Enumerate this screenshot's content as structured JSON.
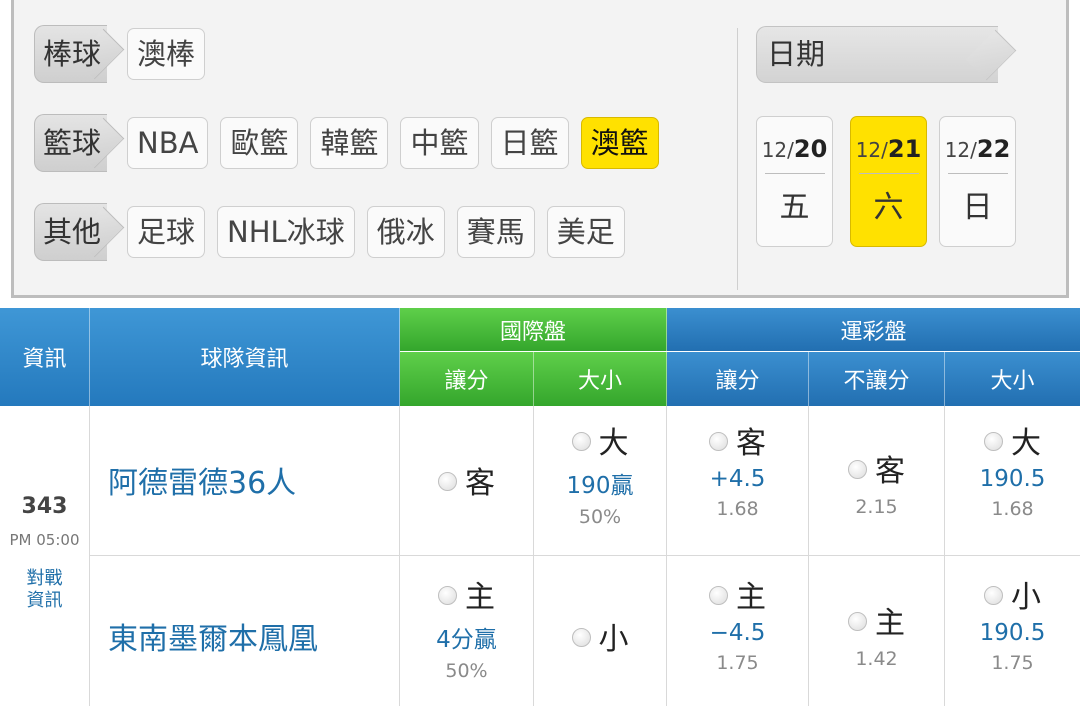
{
  "filters": {
    "rows": [
      {
        "label": "棒球",
        "chips": [
          {
            "text": "澳棒",
            "selected": false
          }
        ]
      },
      {
        "label": "籃球",
        "chips": [
          {
            "text": "NBA",
            "selected": false
          },
          {
            "text": "歐籃",
            "selected": false
          },
          {
            "text": "韓籃",
            "selected": false
          },
          {
            "text": "中籃",
            "selected": false
          },
          {
            "text": "日籃",
            "selected": false
          },
          {
            "text": "澳籃",
            "selected": true
          }
        ]
      },
      {
        "label": "其他",
        "chips": [
          {
            "text": "足球",
            "selected": false
          },
          {
            "text": "NHL冰球",
            "selected": false
          },
          {
            "text": "俄冰",
            "selected": false
          },
          {
            "text": "賽馬",
            "selected": false
          },
          {
            "text": "美足",
            "selected": false
          }
        ]
      }
    ],
    "date_label": "日期",
    "dates": [
      {
        "month": "12/",
        "day": "20",
        "weekday": "五",
        "selected": false
      },
      {
        "month": "12/",
        "day": "21",
        "weekday": "六",
        "selected": true
      },
      {
        "month": "12/",
        "day": "22",
        "weekday": "日",
        "selected": false
      }
    ]
  },
  "table": {
    "headers": {
      "info": "資訊",
      "team_info": "球隊資訊",
      "intl": "國際盤",
      "intl_spread": "讓分",
      "intl_total": "大小",
      "lottery": "運彩盤",
      "lot_spread": "讓分",
      "lot_moneyline": "不讓分",
      "lot_total": "大小"
    },
    "game": {
      "number": "343",
      "time": "PM 05:00",
      "matchup_line1": "對戰",
      "matchup_line2": "資訊",
      "away": {
        "team": "阿德雷德36人",
        "intl_spread": {
          "main": "客"
        },
        "intl_total": {
          "main": "大",
          "val": "190贏",
          "sub": "50%"
        },
        "lot_spread": {
          "main": "客",
          "val": "+4.5",
          "sub": "1.68"
        },
        "lot_moneyline": {
          "main": "客",
          "sub": "2.15"
        },
        "lot_total": {
          "main": "大",
          "val": "190.5",
          "sub": "1.68"
        }
      },
      "home": {
        "team": "東南墨爾本鳳凰",
        "intl_spread": {
          "main": "主",
          "val": "4分贏",
          "sub": "50%"
        },
        "intl_total": {
          "main": "小"
        },
        "lot_spread": {
          "main": "主",
          "val": "−4.5",
          "sub": "1.75"
        },
        "lot_moneyline": {
          "main": "主",
          "sub": "1.42"
        },
        "lot_total": {
          "main": "小",
          "val": "190.5",
          "sub": "1.75"
        }
      }
    }
  },
  "colors": {
    "accent_yellow": "#ffe100",
    "header_blue": "#2b82c5",
    "header_green": "#3fb136",
    "link_blue": "#1f6fa9"
  }
}
